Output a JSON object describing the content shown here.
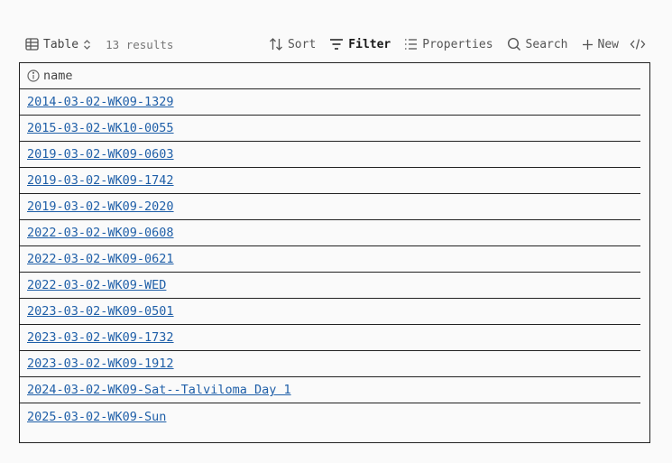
{
  "toolbar": {
    "view_label": "Table",
    "results_count": "13 results",
    "sort_label": "Sort",
    "filter_label": "Filter",
    "properties_label": "Properties",
    "search_label": "Search",
    "new_label": "New"
  },
  "table": {
    "column_header": "name",
    "rows": [
      "2014-03-02-WK09-1329",
      "2015-03-02-WK10-0055",
      "2019-03-02-WK09-0603",
      "2019-03-02-WK09-1742",
      "2019-03-02-WK09-2020",
      "2022-03-02-WK09-0608",
      "2022-03-02-WK09-0621",
      "2022-03-02-WK09-WED",
      "2023-03-02-WK09-0501",
      "2023-03-02-WK09-1732",
      "2023-03-02-WK09-1912",
      "2024-03-02-WK09-Sat--Talviloma Day 1",
      "2025-03-02-WK09-Sun"
    ]
  },
  "icons": {
    "view": "table-grid-icon",
    "view_switch": "chevron-updown-icon",
    "sort": "sort-arrows-icon",
    "filter": "filter-lines-icon",
    "properties": "list-icon",
    "search": "search-icon",
    "new": "plus-icon",
    "embed": "code-icon",
    "column": "info-circle-icon"
  },
  "colors": {
    "link": "#1f5fa8",
    "border": "#222222",
    "background": "#fafafa"
  }
}
